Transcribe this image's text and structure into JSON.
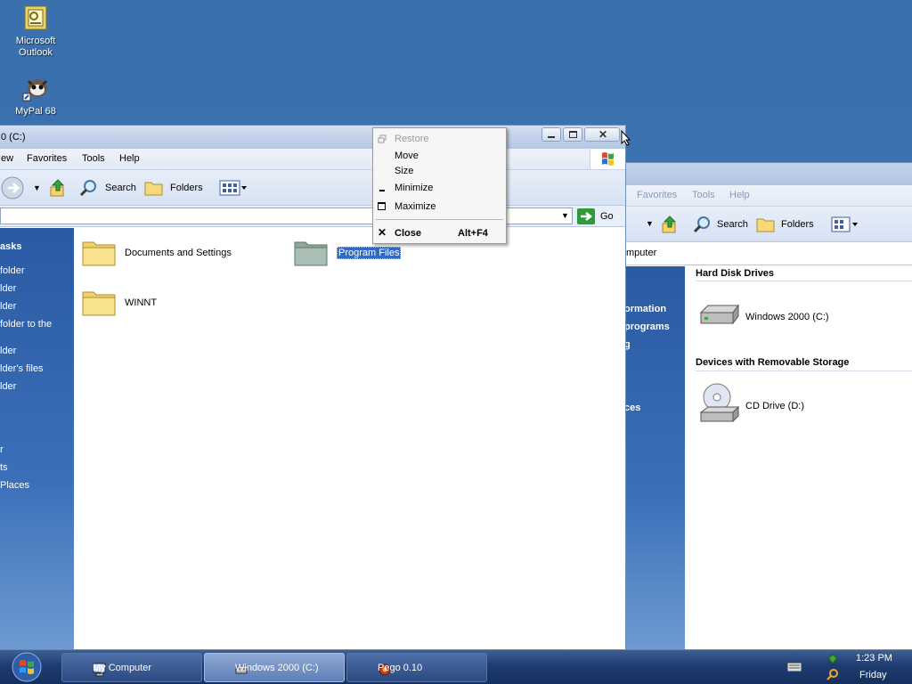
{
  "desktop": {
    "icons": [
      {
        "label_line1": "Microsoft",
        "label_line2": "Outlook",
        "icon": "outlook-icon"
      },
      {
        "label": "MyPal 68",
        "icon": "mypal-icon"
      }
    ]
  },
  "back_window": {
    "menu": {
      "favorites": "Favorites",
      "tools": "Tools",
      "help": "Help"
    },
    "toolbar": {
      "search": "Search",
      "folders": "Folders"
    },
    "address": "mputer",
    "taskpane": {
      "item1": "ormation",
      "item2": "programs",
      "item3": "g",
      "item4": "ces"
    },
    "sections": {
      "hard_disk": "Hard Disk Drives",
      "removable": "Devices with Removable Storage"
    },
    "drives": [
      {
        "label": "Windows 2000 (C:)",
        "icon": "hard-drive-icon"
      },
      {
        "label": "CD Drive (D:)",
        "icon": "cd-drive-icon"
      }
    ]
  },
  "front_window": {
    "title": "0 (C:)",
    "menu": {
      "view": "ew",
      "favorites": "Favorites",
      "tools": "Tools",
      "help": "Help"
    },
    "toolbar": {
      "search": "Search",
      "folders": "Folders"
    },
    "go": "Go",
    "taskpane": [
      {
        "text": "asks",
        "bold": true
      },
      {
        "text": "folder"
      },
      {
        "text": "lder"
      },
      {
        "text": "lder"
      },
      {
        "text": "folder to the"
      },
      {
        "text": "lder"
      },
      {
        "text": "lder's files"
      },
      {
        "text": "lder"
      },
      {
        "text": "r"
      },
      {
        "text": "ts"
      },
      {
        "text": "Places"
      }
    ],
    "folders": [
      {
        "label": "Documents and Settings",
        "selected": false
      },
      {
        "label": "Program Files",
        "selected": true
      },
      {
        "label": "WINNT",
        "selected": false
      }
    ]
  },
  "context_menu": {
    "items": [
      {
        "label": "Restore",
        "disabled": true,
        "icon": "restore-icon"
      },
      {
        "label": "Move",
        "disabled": false
      },
      {
        "label": "Size",
        "disabled": false
      },
      {
        "label": "Minimize",
        "disabled": false,
        "icon": "minimize-icon"
      },
      {
        "label": "Maximize",
        "disabled": false,
        "icon": "maximize-icon"
      },
      {
        "label": "Close",
        "shortcut": "Alt+F4",
        "bold": true,
        "icon": "close-icon"
      }
    ]
  },
  "taskbar": {
    "buttons": [
      {
        "label": "My Computer",
        "icon": "computer-icon",
        "active": false
      },
      {
        "label": "Windows 2000 (C:)",
        "icon": "drive-icon",
        "active": true
      },
      {
        "label": "Pego 0.10",
        "icon": "pego-icon",
        "active": false
      }
    ],
    "clock": {
      "time": "1:23 PM",
      "day": "Friday"
    }
  },
  "colors": {
    "desktop": "#3a6ea5",
    "selection": "#316ac5",
    "taskbar": "#1f3c70"
  }
}
